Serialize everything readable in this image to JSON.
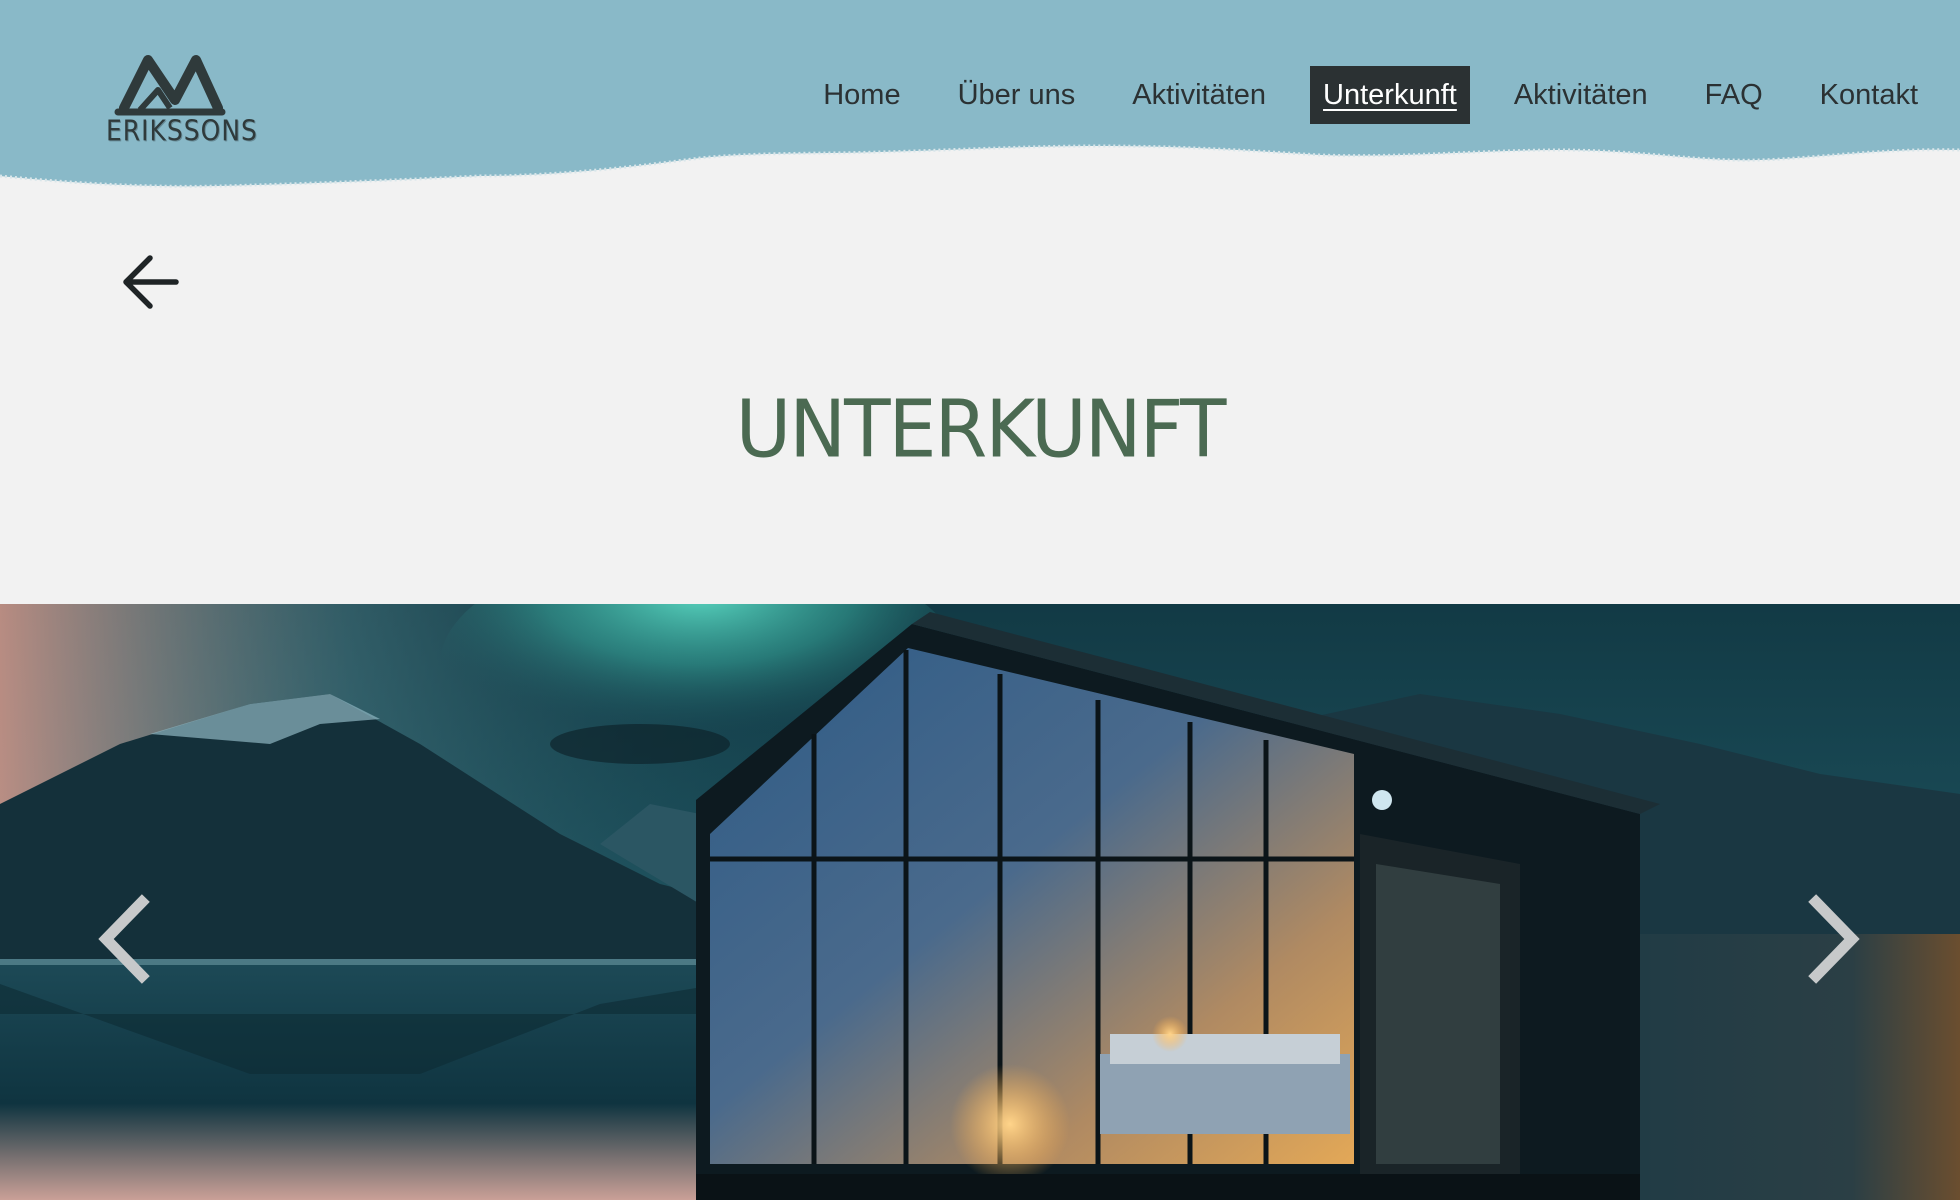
{
  "brand": {
    "name": "ERIKSSONS"
  },
  "nav": {
    "items": [
      {
        "label": "Home"
      },
      {
        "label": "Über uns"
      },
      {
        "label": "Aktivitäten"
      },
      {
        "label": "Unterkunft",
        "active": true
      },
      {
        "label": "Aktivitäten"
      },
      {
        "label": "FAQ"
      },
      {
        "label": "Kontakt"
      }
    ]
  },
  "page": {
    "title": "UNTERKUNFT"
  },
  "slider": {
    "image": "glass-cabin-northern-lights"
  },
  "icons": {
    "back": "arrow-left-icon",
    "prev": "chevron-left-icon",
    "next": "chevron-right-icon"
  },
  "colors": {
    "header": "#89b9c8",
    "page": "#f2f2f2",
    "title": "#4b6a52",
    "nav_active": "#2b3133"
  }
}
